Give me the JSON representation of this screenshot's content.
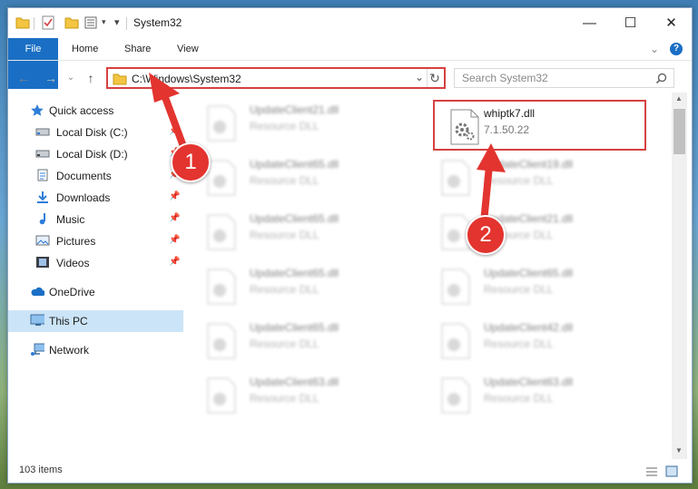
{
  "window": {
    "title": "System32"
  },
  "ribbon": {
    "tabs": [
      "File",
      "Home",
      "Share",
      "View"
    ]
  },
  "address": {
    "path": "C:\\Windows\\System32"
  },
  "search": {
    "placeholder": "Search System32"
  },
  "nav": {
    "items": [
      {
        "label": "Quick access",
        "icon": "star-icon"
      },
      {
        "label": "Local Disk (C:)",
        "icon": "drive-icon"
      },
      {
        "label": "Local Disk (D:)",
        "icon": "drive-icon"
      },
      {
        "label": "Documents",
        "icon": "document-icon"
      },
      {
        "label": "Downloads",
        "icon": "download-icon"
      },
      {
        "label": "Music",
        "icon": "music-icon"
      },
      {
        "label": "Pictures",
        "icon": "picture-icon"
      },
      {
        "label": "Videos",
        "icon": "video-icon"
      },
      {
        "label": "OneDrive",
        "icon": "cloud-icon"
      },
      {
        "label": "This PC",
        "icon": "monitor-icon"
      },
      {
        "label": "Network",
        "icon": "network-icon"
      }
    ]
  },
  "files": {
    "highlighted": {
      "name": "whiptk7.dll",
      "version": "7.1.50.22"
    },
    "items": [
      {
        "name": "UpdateClient21.dll",
        "type": "Resource DLL"
      },
      {
        "name": "UpdateClient65.dll",
        "type": "Resource DLL"
      },
      {
        "name": "UpdateClient19.dll",
        "type": "Resource DLL"
      },
      {
        "name": "UpdateClient65.dll",
        "type": "Resource DLL"
      },
      {
        "name": "UpdateClient21.dll",
        "type": "Resource DLL"
      },
      {
        "name": "UpdateClient65.dll",
        "type": "Resource DLL"
      },
      {
        "name": "UpdateClient65.dll",
        "type": "Resource DLL"
      },
      {
        "name": "UpdateClient65.dll",
        "type": "Resource DLL"
      },
      {
        "name": "UpdateClient42.dll",
        "type": "Resource DLL"
      },
      {
        "name": "UpdateClient63.dll",
        "type": "Resource DLL"
      },
      {
        "name": "UpdateClient63.dll",
        "type": "Resource DLL"
      }
    ]
  },
  "status": {
    "count": "103 items"
  },
  "annotations": {
    "step1": "1",
    "step2": "2"
  },
  "colors": {
    "accent": "#1a6fc4",
    "highlight": "#d64141",
    "selected": "#cce4f7"
  }
}
